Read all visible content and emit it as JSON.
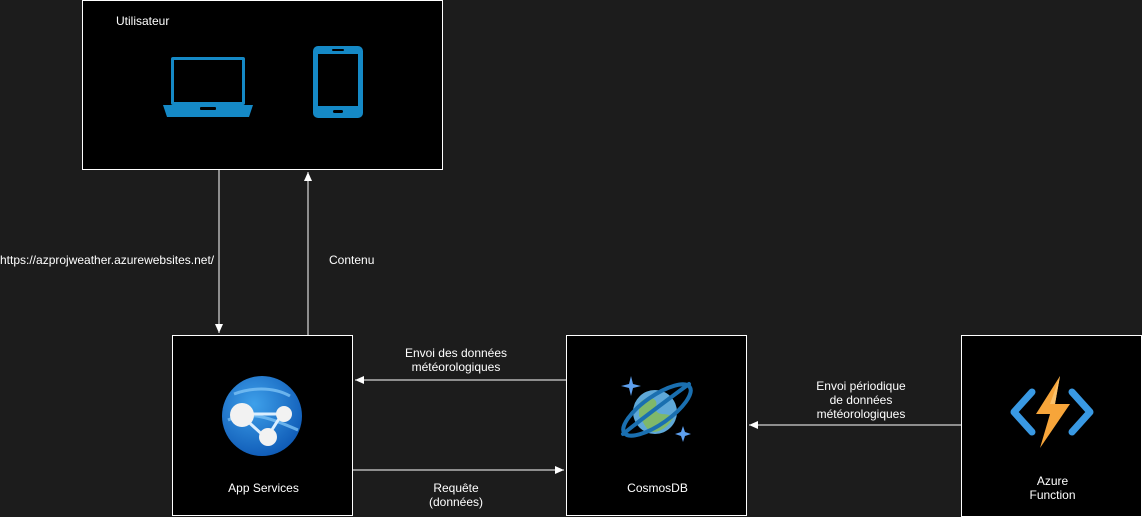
{
  "nodes": {
    "user": {
      "title": "Utilisateur"
    },
    "app_services": {
      "label": "App Services"
    },
    "cosmosdb": {
      "label": "CosmosDB"
    },
    "azure_function": {
      "label_line1": "Azure",
      "label_line2": "Function"
    }
  },
  "edges": {
    "url": "https://azprojweather.azurewebsites.net/",
    "contenu": "Contenu",
    "envoi_donnees_line1": "Envoi des données",
    "envoi_donnees_line2": "météorologiques",
    "requete_line1": "Requête",
    "requete_line2": "(données)",
    "envoi_periodique_line1": "Envoi périodique",
    "envoi_periodique_line2": "de données",
    "envoi_periodique_line3": "météorologiques"
  },
  "icons": {
    "laptop": "laptop-icon",
    "phone": "smartphone-icon",
    "app_services": "app-services-globe-icon",
    "cosmosdb": "cosmosdb-planet-icon",
    "function": "azure-function-bolt-icon"
  },
  "colors": {
    "background": "#1c1c1c",
    "node_fill": "#000000",
    "stroke": "#ffffff",
    "device_blue": "#1589c6"
  }
}
